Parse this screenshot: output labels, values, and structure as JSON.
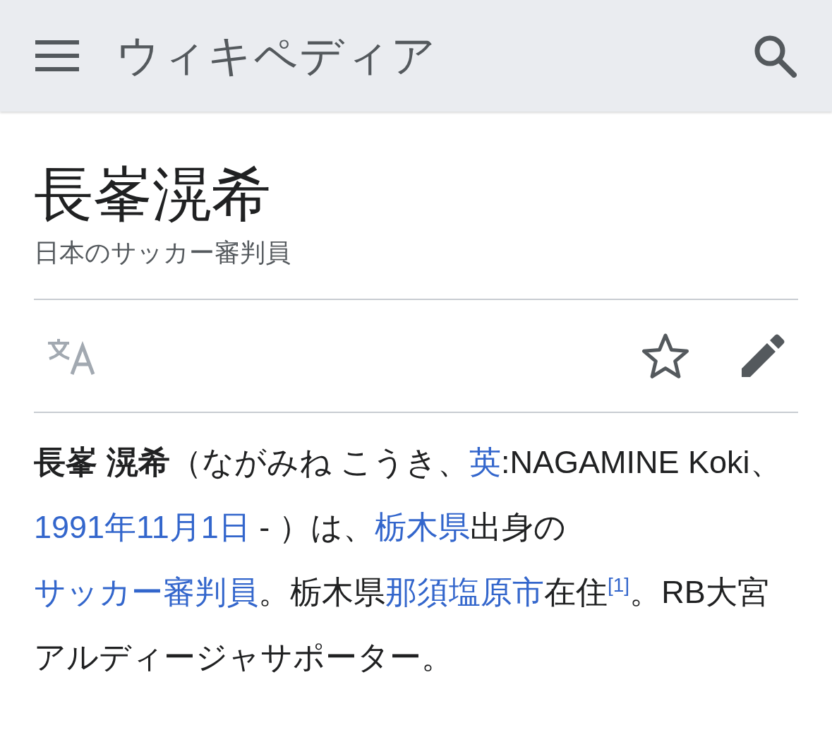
{
  "header": {
    "title": "ウィキペディア"
  },
  "article": {
    "title": "長峯滉希",
    "description": "日本のサッカー審判員"
  },
  "paragraphs": [
    [
      {
        "kind": "bold",
        "text": "長峯 滉希"
      },
      {
        "kind": "text",
        "text": "（ながみね こうき、"
      },
      {
        "kind": "link",
        "text": "英"
      },
      {
        "kind": "text",
        "text": ":NAGAMINE Koki、"
      },
      {
        "kind": "link",
        "text": "1991年11月1日"
      },
      {
        "kind": "text",
        "text": " - ）は、"
      },
      {
        "kind": "link",
        "text": "栃木県"
      },
      {
        "kind": "text",
        "text": "出身の"
      },
      {
        "kind": "link",
        "text": "サッカー審判員"
      },
      {
        "kind": "text",
        "text": "。栃木県"
      },
      {
        "kind": "link",
        "text": "那須塩原市"
      },
      {
        "kind": "text",
        "text": "在住"
      },
      {
        "kind": "ref",
        "text": "[1]"
      },
      {
        "kind": "text",
        "text": "。RB大宮アルディージャサポーター。"
      }
    ]
  ]
}
